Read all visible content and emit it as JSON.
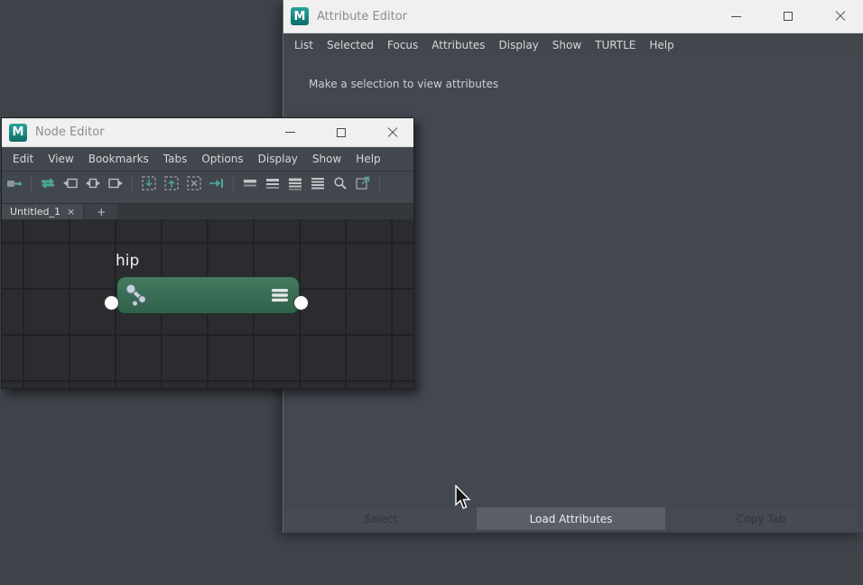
{
  "app": {
    "logo_letter": "M"
  },
  "attribute_editor": {
    "title": "Attribute Editor",
    "menu": [
      "List",
      "Selected",
      "Focus",
      "Attributes",
      "Display",
      "Show",
      "TURTLE",
      "Help"
    ],
    "message": "Make a selection to view attributes",
    "footer_buttons": [
      {
        "label": "Select"
      },
      {
        "label": "Load Attributes"
      },
      {
        "label": "Copy Tab"
      }
    ]
  },
  "node_editor": {
    "title": "Node Editor",
    "menu": [
      "Edit",
      "View",
      "Bookmarks",
      "Tabs",
      "Options",
      "Display",
      "Show",
      "Help"
    ],
    "toolbar_icons": [
      "create-node-icon",
      "sync-selection-icon",
      "input-connections-icon",
      "input-output-connections-icon",
      "output-connections-icon",
      "add-to-graph-icon",
      "remove-from-graph-icon",
      "clear-graph-icon",
      "pin-selection-icon",
      "show-no-attributes-icon",
      "show-connected-attributes-icon",
      "show-primary-attributes-icon",
      "show-all-attributes-icon",
      "search-icon",
      "open-in-window-icon"
    ],
    "tab": {
      "label": "Untitled_1",
      "close": "×"
    },
    "add_tab": "+",
    "node": {
      "label": "hip"
    }
  },
  "colors": {
    "node_fill": "#3c6f56",
    "accent_teal": "#49a79b",
    "canvas": "#2b2c30"
  }
}
